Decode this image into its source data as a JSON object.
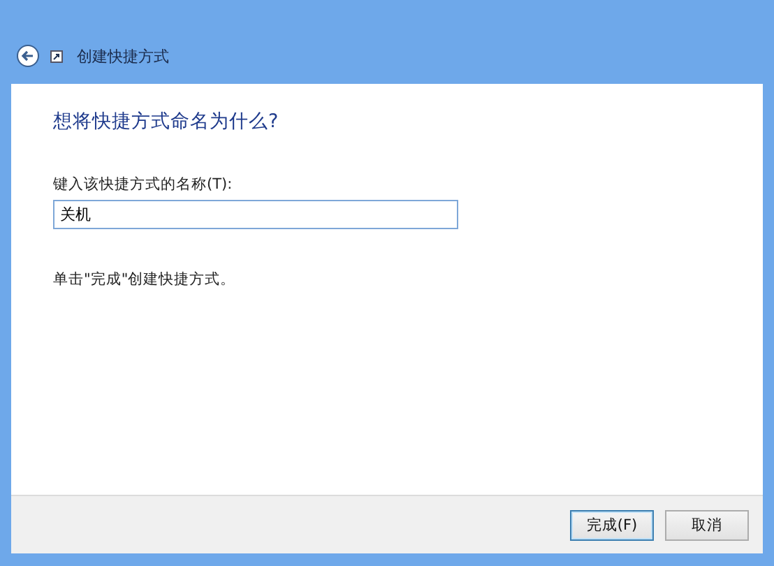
{
  "window": {
    "title": "创建快捷方式"
  },
  "heading": "想将快捷方式命名为什么?",
  "name_field": {
    "label": "键入该快捷方式的名称(T):",
    "value": "关机"
  },
  "instruction": "单击\"完成\"创建快捷方式。",
  "buttons": [
    {
      "label": "完成(F)",
      "default": true
    },
    {
      "label": "取消",
      "default": false
    }
  ]
}
